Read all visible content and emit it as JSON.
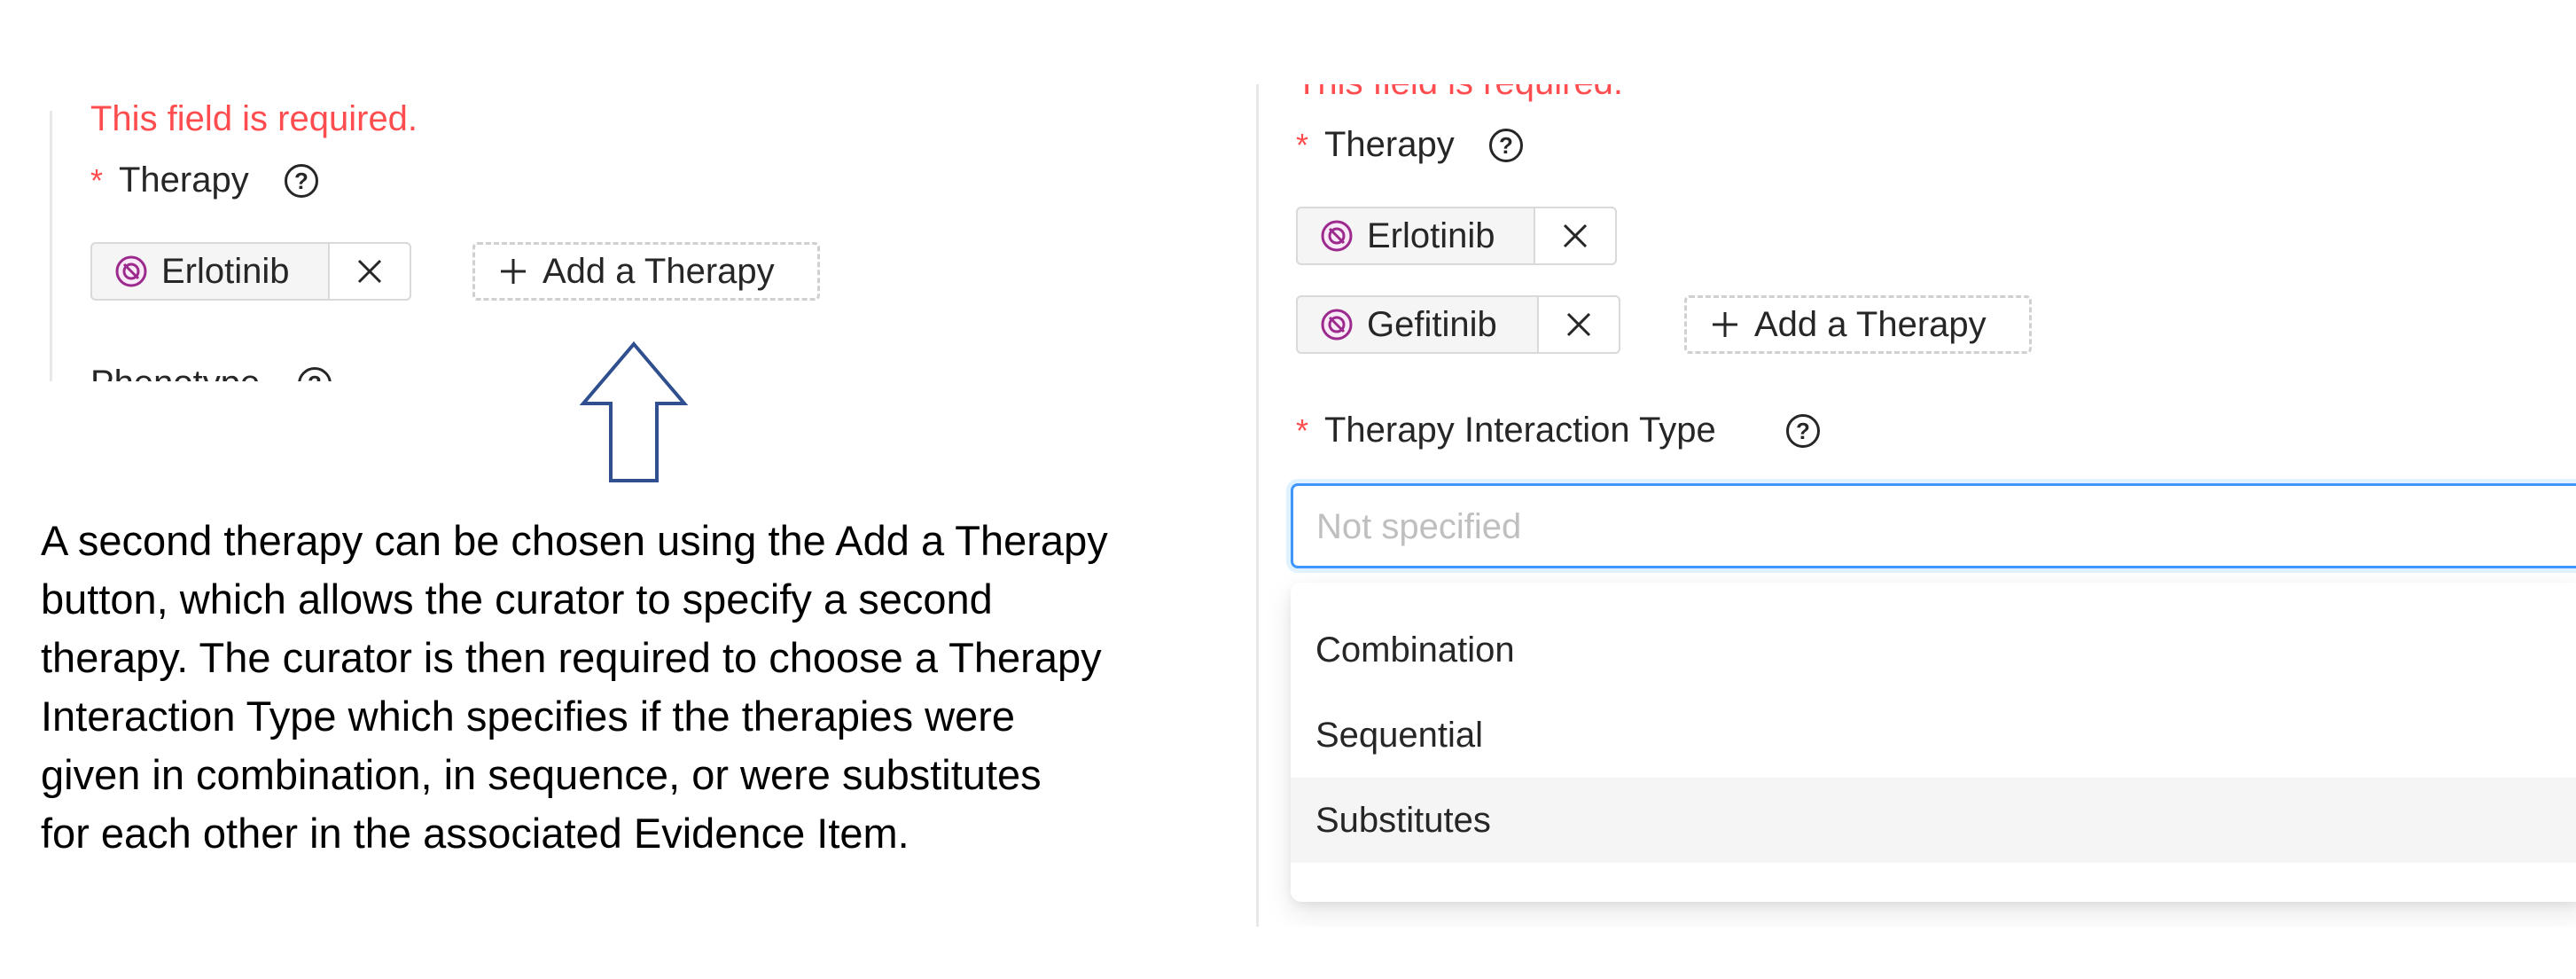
{
  "colors": {
    "required": "#ff4d4f",
    "focus_border": "#4096ff",
    "drug_icon": "#9c2a8e",
    "arrow_stroke": "#2f4f8f"
  },
  "left_form": {
    "error_text": "This field is required.",
    "required_mark": "*",
    "therapy_label": "Therapy",
    "therapy_tags": [
      "Erlotinib"
    ],
    "close_glyph": "X",
    "add_button": "Add a Therapy",
    "next_label": "Phenotype"
  },
  "right_form": {
    "error_text": "This field is required.",
    "required_mark": "*",
    "therapy_label": "Therapy",
    "therapy_tags": [
      "Erlotinib",
      "Gefitinib"
    ],
    "close_glyph": "X",
    "add_button": "Add a Therapy",
    "interaction_label": "Therapy Interaction Type",
    "interaction_placeholder": "Not specified",
    "options": [
      "Combination",
      "Sequential",
      "Substitutes"
    ],
    "active_option": "Substitutes"
  },
  "icons": {
    "help": "question-circle-icon",
    "drug": "drug-icon",
    "add": "plus-icon",
    "close": "close-icon",
    "arrow": "up-arrow"
  },
  "caption": [
    "A second therapy can be chosen using the Add a Therapy",
    "button, which allows the curator to specify a second",
    "therapy. The curator is then required to choose a Therapy",
    "Interaction Type which specifies if the therapies were",
    "given in combination, in sequence, or were substitutes",
    "for each other in the associated Evidence Item."
  ]
}
